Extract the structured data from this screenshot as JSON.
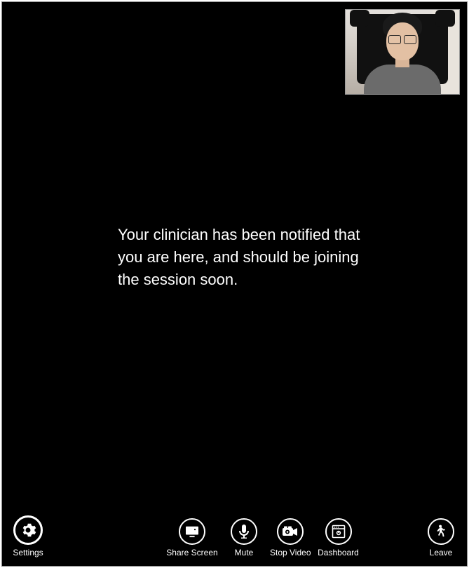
{
  "waiting_message": "Your clinician has been notified that you are here, and should be joining the session soon.",
  "self_view": {
    "label": "self-camera-preview"
  },
  "toolbar": {
    "settings": "Settings",
    "share_screen": "Share Screen",
    "mute": "Mute",
    "stop_video": "Stop Video",
    "dashboard": "Dashboard",
    "leave": "Leave"
  }
}
